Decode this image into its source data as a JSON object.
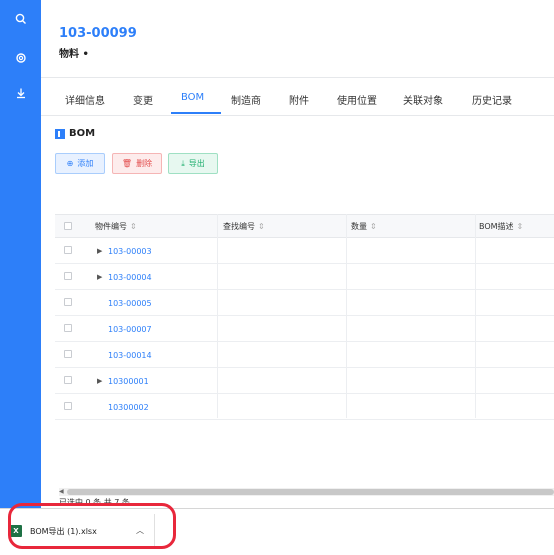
{
  "sidebar": {
    "icons": [
      "search-icon",
      "settings-icon",
      "download-icon"
    ]
  },
  "header": {
    "title": "103-00099",
    "subtitle": "物料 •"
  },
  "tabs": [
    "详细信息",
    "变更",
    "BOM",
    "制造商",
    "附件",
    "使用位置",
    "关联对象",
    "历史记录"
  ],
  "active_tab": "BOM",
  "section": {
    "title": "BOM"
  },
  "toolbar": {
    "add_label": "添加",
    "delete_label": "删除",
    "export_label": "导出"
  },
  "table": {
    "columns": [
      "物件编号",
      "查找编号",
      "数量",
      "BOM描述"
    ],
    "rows": [
      {
        "id": "103-00003",
        "expandable": true
      },
      {
        "id": "103-00004",
        "expandable": true
      },
      {
        "id": "103-00005",
        "expandable": false
      },
      {
        "id": "103-00007",
        "expandable": false
      },
      {
        "id": "103-00014",
        "expandable": false
      },
      {
        "id": "10300001",
        "expandable": true
      },
      {
        "id": "10300002",
        "expandable": false
      }
    ]
  },
  "pagination": {
    "text": "已选中 0 条 共 7 条"
  },
  "downloads": {
    "file_name": "BOM导出 (1).xlsx",
    "icon": "excel-file-icon"
  },
  "colors": {
    "accent": "#2d7ff9",
    "sidebar": "#2d7ff9",
    "delete": "#e34d4d",
    "export": "#1fae6e",
    "highlight": "#e8273b"
  }
}
